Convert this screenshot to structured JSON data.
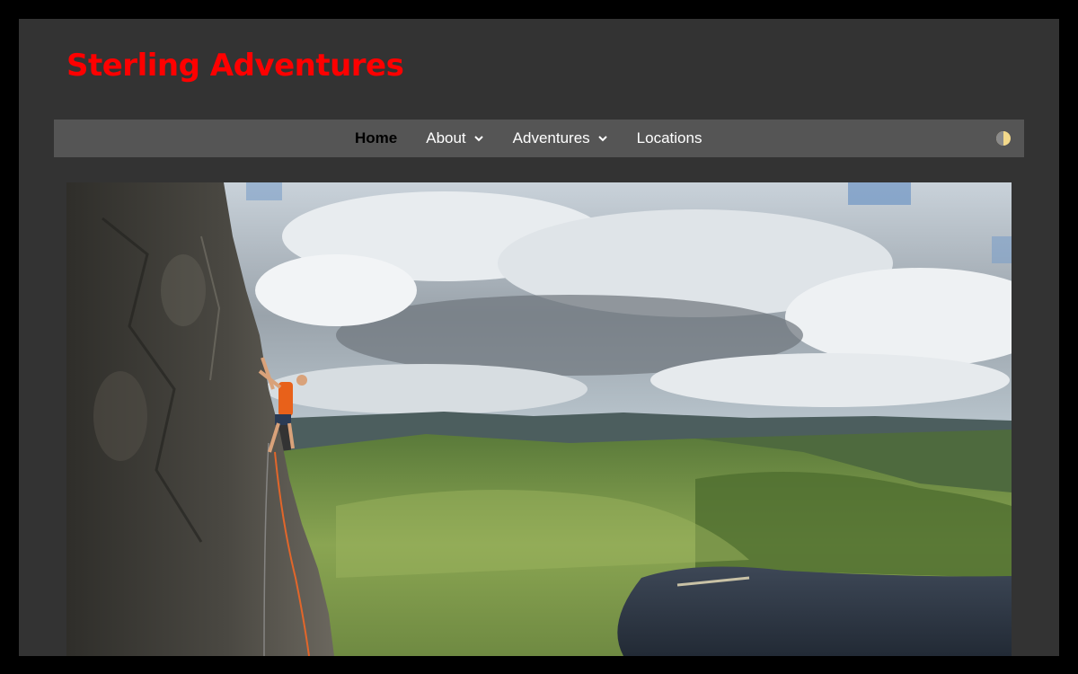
{
  "site": {
    "title": "Sterling Adventures",
    "title_color": "#ff0000"
  },
  "nav": {
    "items": [
      {
        "label": "Home",
        "active": true,
        "has_dropdown": false
      },
      {
        "label": "About",
        "active": false,
        "has_dropdown": true
      },
      {
        "label": "Adventures",
        "active": false,
        "has_dropdown": true
      },
      {
        "label": "Locations",
        "active": false,
        "has_dropdown": false
      }
    ],
    "theme_toggle_icon": "half-circle-contrast-icon"
  },
  "hero": {
    "description_icon": "rock-climber-photo"
  },
  "colors": {
    "page_bg": "#333333",
    "nav_bg": "#555555",
    "outer_bg": "#000000"
  }
}
